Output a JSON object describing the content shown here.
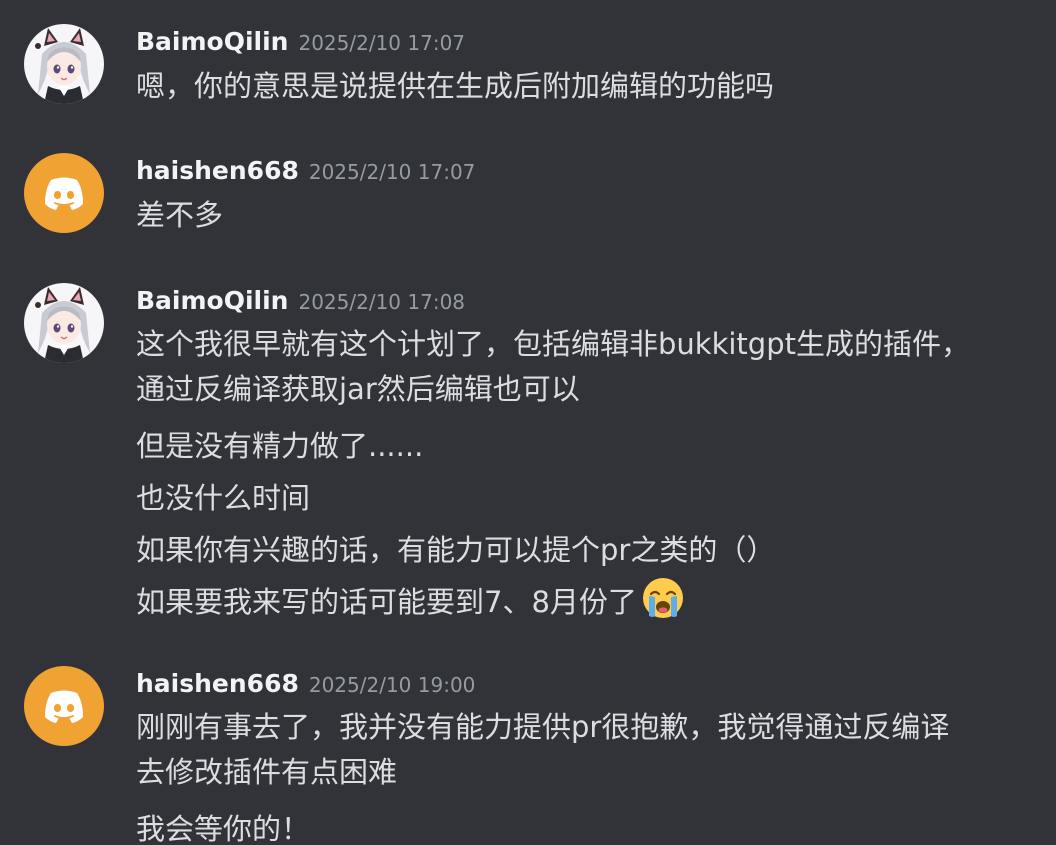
{
  "messages": [
    {
      "author": "BaimoQilin",
      "avatar": "anime-catgirl-avatar",
      "timestamp": "2025/2/10 17:07",
      "lines": [
        "嗯，你的意思是说提供在生成后附加编辑的功能吗"
      ]
    },
    {
      "author": "haishen668",
      "avatar": "discord-default-avatar",
      "timestamp": "2025/2/10 17:07",
      "lines": [
        "差不多"
      ]
    },
    {
      "author": "BaimoQilin",
      "avatar": "anime-catgirl-avatar",
      "timestamp": "2025/2/10 17:08",
      "lines": [
        "这个我很早就有这个计划了，包括编辑非bukkitgpt生成的插件，通过反编译获取jar然后编辑也可以",
        "但是没有精力做了......",
        "也没什么时间",
        "如果你有兴趣的话，有能力可以提个pr之类的（）",
        "如果要我来写的话可能要到7、8月份了"
      ],
      "emoji": "loudly-crying-face"
    },
    {
      "author": "haishen668",
      "avatar": "discord-default-avatar",
      "timestamp": "2025/2/10 19:00",
      "lines": [
        "刚刚有事去了，我并没有能力提供pr很抱歉，我觉得通过反编译去修改插件有点困难",
        "我会等你的！"
      ]
    }
  ],
  "colors": {
    "background": "#313338",
    "username": "#f2f3f5",
    "timestamp": "#949ba4",
    "text": "#dbdee1",
    "discord_avatar": "#f0a232"
  }
}
